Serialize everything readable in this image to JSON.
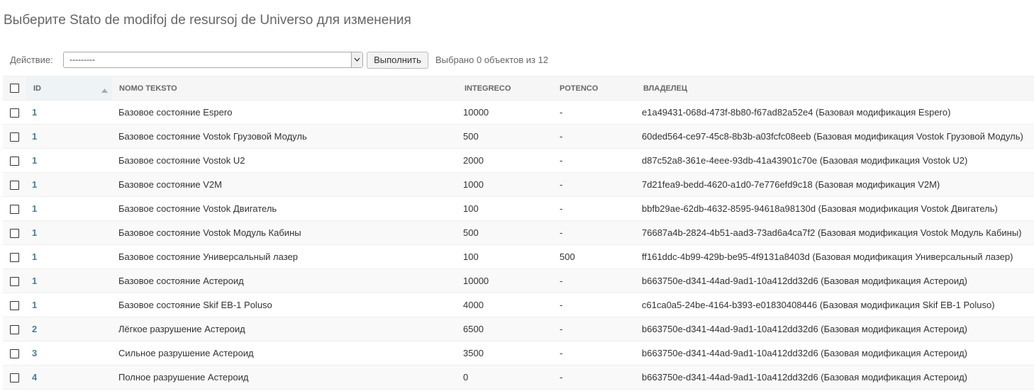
{
  "page": {
    "title": "Выберите Stato de modifoj de resursoj de Universo для изменения"
  },
  "actions": {
    "label": "Действие:",
    "selected_value": "---------",
    "go_label": "Выполнить",
    "counter": "Выбрано 0 объектов из 12"
  },
  "table": {
    "headers": {
      "id": "ID",
      "nomo": "NOMO TEKSTO",
      "integreco": "INTEGRECO",
      "potenco": "POTENCO",
      "owner": "ВЛАДЕЛЕЦ"
    },
    "sort": {
      "column": "id",
      "direction": "ascending",
      "icon": "sort-up-icon"
    },
    "rows": [
      {
        "id": "1",
        "nomo": "Базовое состояние Espero",
        "integreco": "10000",
        "potenco": "-",
        "owner": "e1a49431-068d-473f-8b80-f67ad82a52e4 (Базовая модификация Espero)"
      },
      {
        "id": "1",
        "nomo": "Базовое состояние Vostok Грузовой Модуль",
        "integreco": "500",
        "potenco": "-",
        "owner": "60ded564-ce97-45c8-8b3b-a03fcfc08eeb (Базовая модификация Vostok Грузовой Модуль)"
      },
      {
        "id": "1",
        "nomo": "Базовое состояние Vostok U2",
        "integreco": "2000",
        "potenco": "-",
        "owner": "d87c52a8-361e-4eee-93db-41a43901c70e (Базовая модификация Vostok U2)"
      },
      {
        "id": "1",
        "nomo": "Базовое состояние V2M",
        "integreco": "1000",
        "potenco": "-",
        "owner": "7d21fea9-bedd-4620-a1d0-7e776efd9c18 (Базовая модификация V2M)"
      },
      {
        "id": "1",
        "nomo": "Базовое состояние Vostok Двигатель",
        "integreco": "100",
        "potenco": "-",
        "owner": "bbfb29ae-62db-4632-8595-94618a98130d (Базовая модификация Vostok Двигатель)"
      },
      {
        "id": "1",
        "nomo": "Базовое состояние Vostok Модуль Кабины",
        "integreco": "500",
        "potenco": "-",
        "owner": "76687a4b-2824-4b51-aad3-73ad6a4ca7f2 (Базовая модификация Vostok Модуль Кабины)"
      },
      {
        "id": "1",
        "nomo": "Базовое состояние Универсальный лазер",
        "integreco": "100",
        "potenco": "500",
        "owner": "ff161ddc-4b99-429b-be95-4f9131a8403d (Базовая модификация Универсальный лазер)"
      },
      {
        "id": "1",
        "nomo": "Базовое состояние Астероид",
        "integreco": "10000",
        "potenco": "-",
        "owner": "b663750e-d341-44ad-9ad1-10a412dd32d6 (Базовая модификация Астероид)"
      },
      {
        "id": "1",
        "nomo": "Базовое состояние Skif EB-1 Poluso",
        "integreco": "4000",
        "potenco": "-",
        "owner": "c61ca0a5-24be-4164-b393-e01830408446 (Базовая модификация Skif EB-1 Poluso)"
      },
      {
        "id": "2",
        "nomo": "Лёгкое разрушение Астероид",
        "integreco": "6500",
        "potenco": "-",
        "owner": "b663750e-d341-44ad-9ad1-10a412dd32d6 (Базовая модификация Астероид)"
      },
      {
        "id": "3",
        "nomo": "Сильное разрушение Астероид",
        "integreco": "3500",
        "potenco": "-",
        "owner": "b663750e-d341-44ad-9ad1-10a412dd32d6 (Базовая модификация Астероид)"
      },
      {
        "id": "4",
        "nomo": "Полное разрушение Астероид",
        "integreco": "0",
        "potenco": "-",
        "owner": "b663750e-d341-44ad-9ad1-10a412dd32d6 (Базовая модификация Астероид)"
      }
    ]
  },
  "colors": {
    "link": "#447e9b",
    "header_bg": "#f6f6f6",
    "row_alt_bg": "#f9f9f9"
  }
}
